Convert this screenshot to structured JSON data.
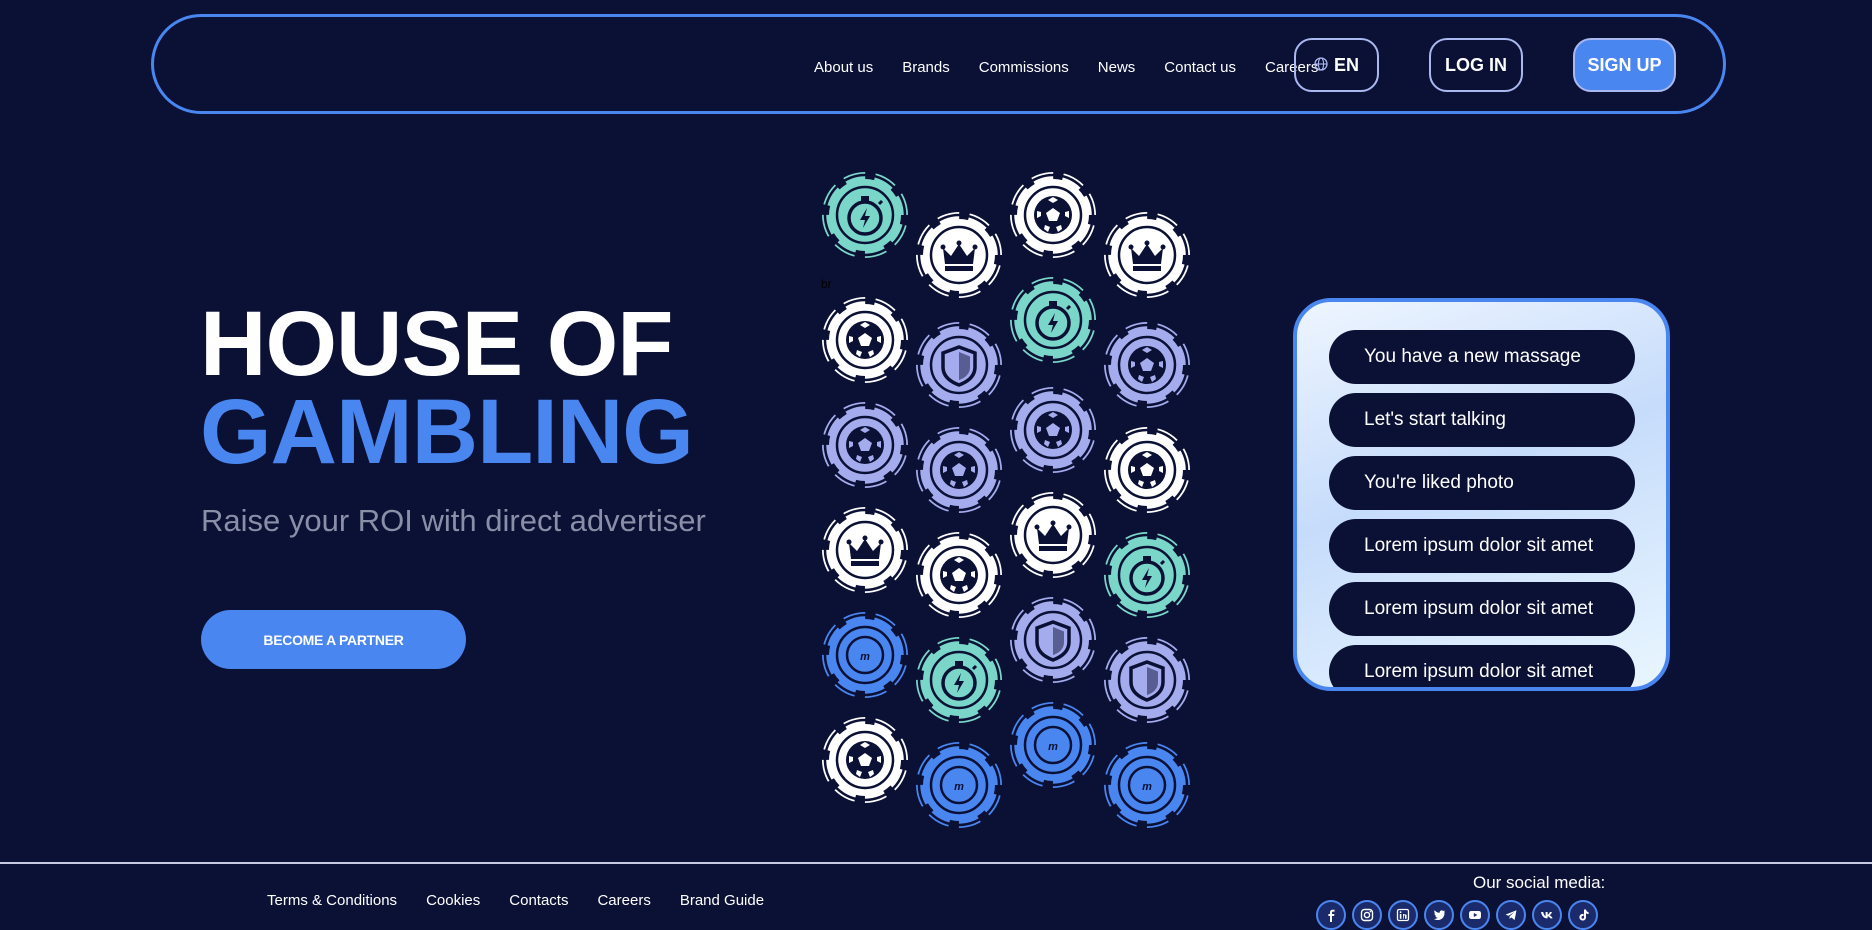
{
  "header": {
    "nav": [
      {
        "label": "About us"
      },
      {
        "label": "Brands"
      },
      {
        "label": "Commissions"
      },
      {
        "label": "News"
      },
      {
        "label": "Contact us"
      },
      {
        "label": "Careers"
      }
    ],
    "language": "EN",
    "login_label": "LOG IN",
    "signup_label": "SIGN UP"
  },
  "hero": {
    "title_line1": "HOUSE OF",
    "title_line2": "GAMBLING",
    "subtitle": "Raise your ROI with direct advertiser",
    "cta_label": "Become a partner",
    "stray_text": "br"
  },
  "chips": [
    {
      "icon": "stopwatch-icon",
      "color": "#7ad6c8"
    },
    {
      "icon": "crown-icon",
      "color": "#ffffff"
    },
    {
      "icon": "soccer-ball-icon",
      "color": "#ffffff"
    },
    {
      "icon": "crown-icon",
      "color": "#ffffff"
    },
    {
      "icon": "soccer-ball-icon",
      "color": "#ffffff"
    },
    {
      "icon": "shield-icon",
      "color": "#a4acee"
    },
    {
      "icon": "stopwatch-icon",
      "color": "#7ad6c8"
    },
    {
      "icon": "soccer-ball-icon",
      "color": "#a4acee"
    },
    {
      "icon": "soccer-ball-icon",
      "color": "#a4acee"
    },
    {
      "icon": "soccer-ball-icon",
      "color": "#a4acee"
    },
    {
      "icon": "soccer-ball-icon",
      "color": "#a4acee"
    },
    {
      "icon": "soccer-ball-icon",
      "color": "#ffffff"
    },
    {
      "icon": "crown-icon",
      "color": "#ffffff"
    },
    {
      "icon": "soccer-ball-icon",
      "color": "#ffffff"
    },
    {
      "icon": "crown-icon",
      "color": "#ffffff"
    },
    {
      "icon": "stopwatch-icon",
      "color": "#7ad6c8"
    },
    {
      "icon": "brand-logo-icon",
      "color": "#4a86f0"
    },
    {
      "icon": "stopwatch-icon",
      "color": "#7ad6c8"
    },
    {
      "icon": "shield-icon",
      "color": "#a4acee"
    },
    {
      "icon": "shield-icon",
      "color": "#a4acee"
    },
    {
      "icon": "soccer-ball-icon",
      "color": "#ffffff"
    },
    {
      "icon": "brand-logo-icon",
      "color": "#4a86f0"
    },
    {
      "icon": "brand-logo-icon",
      "color": "#4a86f0"
    },
    {
      "icon": "brand-logo-icon",
      "color": "#4a86f0"
    }
  ],
  "messages": [
    "You have a new massage",
    "Let's start talking",
    "You're liked photo",
    "Lorem ipsum dolor sit amet",
    "Lorem ipsum dolor sit amet",
    "Lorem ipsum dolor sit amet"
  ],
  "footer": {
    "links": [
      {
        "label": "Terms & Conditions"
      },
      {
        "label": "Cookies"
      },
      {
        "label": "Contacts"
      },
      {
        "label": "Careers"
      },
      {
        "label": "Brand Guide"
      }
    ],
    "social_title": "Our social media:",
    "socials": [
      "facebook-icon",
      "instagram-icon",
      "linkedin-icon",
      "twitter-icon",
      "youtube-icon",
      "telegram-icon",
      "vk-icon",
      "tiktok-icon"
    ]
  },
  "colors": {
    "background": "#0b1035",
    "accent": "#4a86f0",
    "teal": "#7ad6c8",
    "lavender": "#a4acee"
  }
}
